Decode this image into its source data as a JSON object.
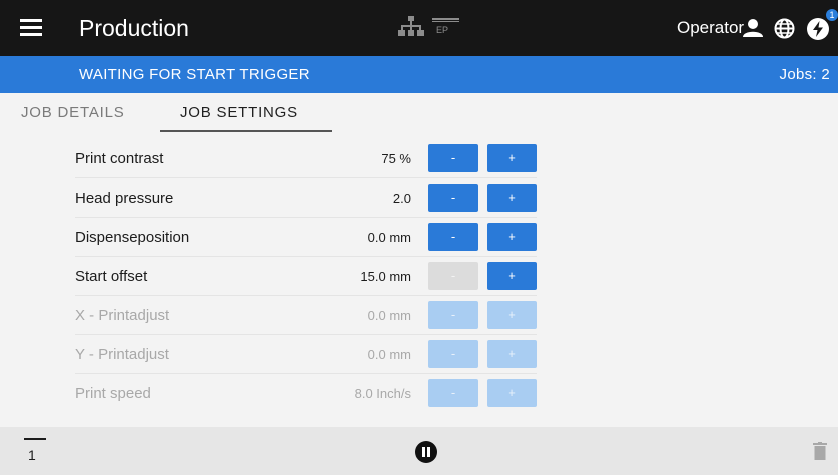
{
  "header": {
    "title": "Production",
    "ep_label": "EP",
    "user": "Operator",
    "notification_count": "1",
    "icons": [
      "menu-icon",
      "network-icon",
      "ep-icon",
      "person-icon",
      "globe-icon",
      "bolt-icon"
    ]
  },
  "status": {
    "message": "WAITING FOR START TRIGGER",
    "jobs": "Jobs: 2"
  },
  "tabs": [
    {
      "label": "JOB DETAILS",
      "active": false
    },
    {
      "label": "JOB SETTINGS",
      "active": true
    }
  ],
  "settings": [
    {
      "label": "Print contrast",
      "value": "75 %",
      "minus": "-",
      "plus": "+",
      "enabled": true
    },
    {
      "label": "Head pressure",
      "value": "2.0",
      "minus": "-",
      "plus": "+",
      "enabled": true
    },
    {
      "label": "Dispenseposition",
      "value": "0.0 mm",
      "minus": "-",
      "plus": "+",
      "enabled": true
    },
    {
      "label": "Start offset",
      "value": "15.0 mm",
      "minus": "-",
      "plus": "+",
      "enabled": true,
      "minus_enabled": false
    },
    {
      "label": "X - Printadjust",
      "value": "0.0 mm",
      "minus": "-",
      "plus": "+",
      "enabled": false
    },
    {
      "label": "Y - Printadjust",
      "value": "0.0 mm",
      "minus": "-",
      "plus": "+",
      "enabled": false
    },
    {
      "label": "Print speed",
      "value": "8.0 Inch/s",
      "minus": "-",
      "plus": "+",
      "enabled": false
    }
  ],
  "footer": {
    "queue_count": "1",
    "icons": [
      "queue-icon",
      "pause-icon",
      "trash-icon"
    ]
  },
  "colors": {
    "accent": "#2a7ad8",
    "header_bg": "#161616",
    "disabled_button": "#a9cdf2"
  }
}
